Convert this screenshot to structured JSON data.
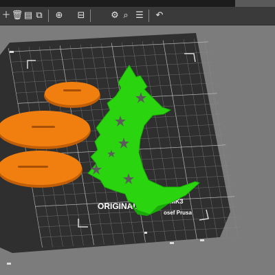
{
  "toolbar": {
    "buttons": [
      {
        "icon": "add-icon",
        "glyph": "＋"
      },
      {
        "icon": "delete-icon",
        "glyph": "🗑"
      },
      {
        "icon": "delete-all-icon",
        "glyph": "▤"
      },
      {
        "icon": "arrange-icon",
        "glyph": "⧉"
      },
      {
        "icon": "copy-icon",
        "glyph": "⊕"
      },
      {
        "icon": "paste-icon",
        "glyph": "⊟"
      },
      {
        "icon": "split-icon",
        "glyph": "⚙"
      },
      {
        "icon": "search-icon",
        "glyph": "⌕"
      },
      {
        "icon": "layers-icon",
        "glyph": "☰"
      },
      {
        "icon": "undo-icon",
        "glyph": "↶"
      }
    ]
  },
  "bed": {
    "brand_text": "ORIGINAL",
    "model_text": "3 MK3",
    "maker_text": "osef Prusa"
  },
  "colors": {
    "background": "#7c7c7c",
    "bed": "#2f2f2f",
    "grid": "#9c9c9c",
    "object_orange": "#f07f0f",
    "object_green": "#2ad40f",
    "toolbar": "#3a3a3a"
  }
}
